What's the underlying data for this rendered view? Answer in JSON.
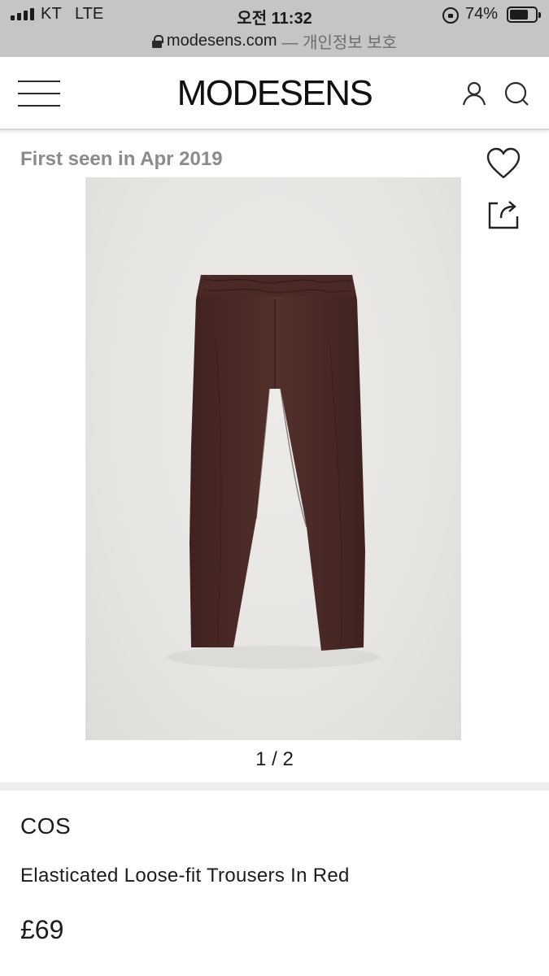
{
  "status_bar": {
    "carrier": "KT",
    "network": "LTE",
    "time": "오전 11:32",
    "battery_percent_label": "74%",
    "battery_level": 0.74,
    "icons": [
      "signal-bars-icon",
      "rotation-lock-icon",
      "battery-icon"
    ]
  },
  "browser": {
    "url": "modesens.com",
    "url_note": "— 개인정보 보호"
  },
  "header": {
    "logo": "MODESENS",
    "icons": [
      "hamburger-menu-icon",
      "user-account-icon",
      "search-icon"
    ]
  },
  "product": {
    "first_seen": "First seen in Apr 2019",
    "image_counter": "1 / 2",
    "image_subject": "brown trousers",
    "brand": "COS",
    "title": "Elasticated Loose-fit Trousers In Red",
    "price": "£69",
    "actions": [
      "heart-wishlist-icon",
      "share-icon"
    ]
  },
  "colors": {
    "status_bar_bg": "#c5c5c5",
    "page_bg": "#ffffff",
    "first_seen_text": "#8b8b8b",
    "image_bg": "#e6e5e2",
    "garment": "#4b2a26",
    "divider": "#eeeeee"
  }
}
